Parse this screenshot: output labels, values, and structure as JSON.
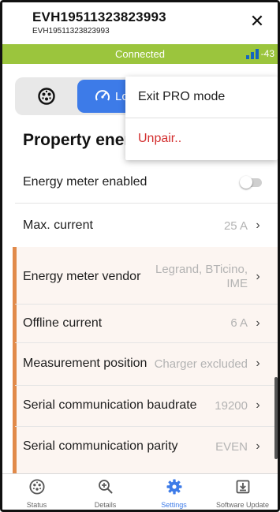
{
  "header": {
    "title": "EVH19511323823993",
    "subtitle": "EVH19511323823993",
    "close_label": "✕"
  },
  "status": {
    "text": "Connected",
    "signal_value": "-43",
    "color": "#9bc53d"
  },
  "modes": {
    "plug_icon": "ev-plug-icon",
    "active_label": "Lo",
    "active_icon": "gauge-icon",
    "active_color": "#3d7be8"
  },
  "section": {
    "title": "Property energ"
  },
  "rows": [
    {
      "label": "Energy meter enabled",
      "value": "",
      "toggle": false
    },
    {
      "label": "Max. current",
      "value": "25 A",
      "chevron": "›"
    },
    {
      "label": "Energy meter vendor",
      "value_line1": "Legrand, BTicino,",
      "value_line2": "IME",
      "chevron": "›"
    },
    {
      "label": "Offline current",
      "value": "6 A",
      "chevron": "›"
    },
    {
      "label": "Measurement position",
      "value": "Charger excluded",
      "chevron": "›"
    },
    {
      "label": "Serial communication baudrate",
      "value": "19200",
      "chevron": "›"
    },
    {
      "label": "Serial communication parity",
      "value": "EVEN",
      "chevron": "›"
    }
  ],
  "menu": {
    "items": [
      {
        "label": "Exit PRO mode",
        "color": "#1e1e1e"
      },
      {
        "label": "Unpair..",
        "color": "#d32f2f"
      }
    ]
  },
  "nav": {
    "items": [
      {
        "label": "Status",
        "icon": "ev-plug-icon",
        "active": false
      },
      {
        "label": "Details",
        "icon": "zoom-in-icon",
        "active": false
      },
      {
        "label": "Settings",
        "icon": "gear-icon",
        "active": true
      },
      {
        "label": "Software Update",
        "icon": "download-box-icon",
        "active": false
      }
    ]
  },
  "accent_color": "#e18a4a"
}
